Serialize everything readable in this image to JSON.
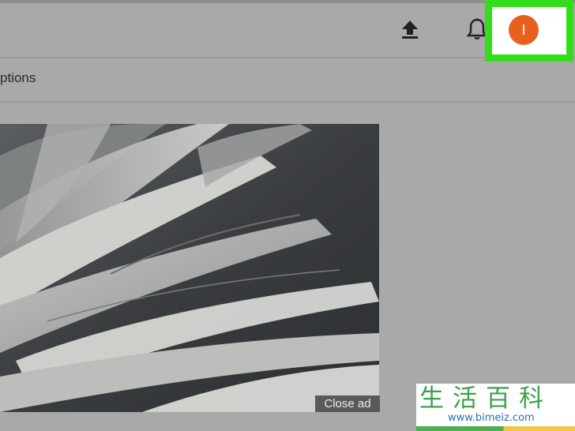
{
  "header": {
    "upload_icon": "upload-icon",
    "notifications_icon": "bell-icon",
    "avatar_initial": "I",
    "avatar_color": "#e8611c",
    "highlight_color": "#33dd1c"
  },
  "subheader": {
    "options_label": "ptions"
  },
  "player": {
    "close_ad_label": "Close ad"
  },
  "watermark": {
    "chars": "生活百科",
    "url": "www.bimeiz.com"
  }
}
